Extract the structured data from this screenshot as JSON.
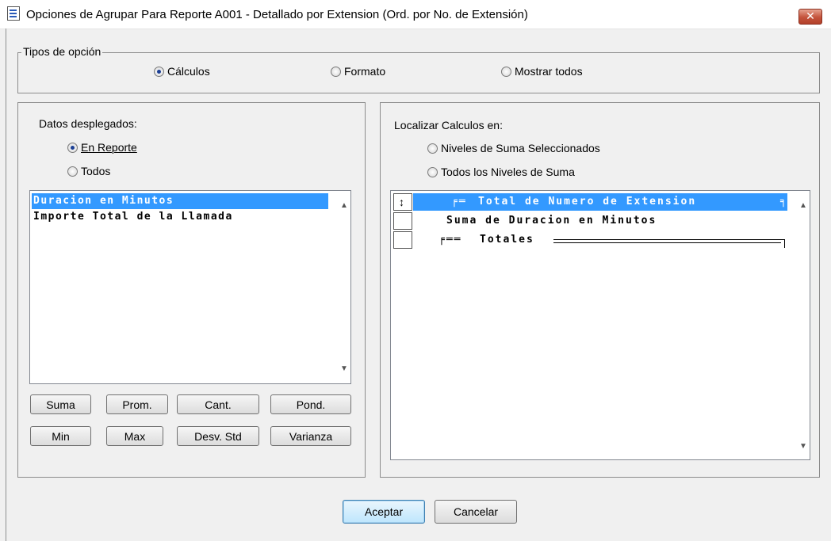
{
  "window": {
    "title": "Opciones de Agrupar Para Reporte A001 - Detallado por Extension (Ord. por No. de Extensión)",
    "close_label": "✕"
  },
  "option_type": {
    "legend": "Tipos de opción",
    "options": [
      {
        "label": "Cálculos",
        "selected": true
      },
      {
        "label": "Formato",
        "selected": false
      },
      {
        "label": "Mostrar todos",
        "selected": false
      }
    ]
  },
  "displayed_data": {
    "label": "Datos desplegados:",
    "options": [
      {
        "label": "En Reporte",
        "selected": true
      },
      {
        "label": "Todos",
        "selected": false
      }
    ],
    "items": [
      {
        "label": "Duracion en Minutos",
        "selected": true
      },
      {
        "label": "Importe Total de la Llamada",
        "selected": false
      }
    ],
    "buttons": [
      {
        "label": "Suma"
      },
      {
        "label": "Prom."
      },
      {
        "label": "Cant."
      },
      {
        "label": "Pond."
      },
      {
        "label": "Min"
      },
      {
        "label": "Max"
      },
      {
        "label": "Desv. Std"
      },
      {
        "label": "Varianza"
      }
    ]
  },
  "locate_calcs": {
    "label": "Localizar Calculos en:",
    "options": [
      {
        "label": "Niveles de Suma Seleccionados",
        "selected": false
      },
      {
        "label": "Todos los Niveles de Suma",
        "selected": false
      }
    ],
    "rows": [
      {
        "label": "Total de Numero de Extension",
        "selected": true,
        "marker": "↕"
      },
      {
        "label": "Suma de Duracion en Minutos",
        "selected": false,
        "marker": ""
      },
      {
        "label": "Totales",
        "selected": false,
        "marker": ""
      }
    ]
  },
  "footer": {
    "accept_label": "Aceptar",
    "cancel_label": "Cancelar"
  },
  "colors": {
    "selection": "#3399ff",
    "background": "#f0f0f0"
  }
}
